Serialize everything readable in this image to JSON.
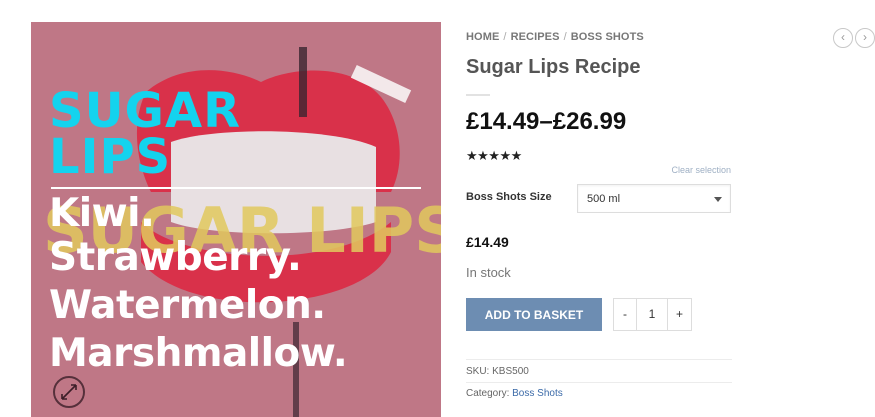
{
  "image": {
    "title_line1": "SUGAR",
    "title_line2": "LIPS",
    "flavors": [
      "Kiwi.",
      "Strawberry.",
      "Watermelon.",
      "Marshmallow."
    ],
    "background_color": "#bf7786",
    "title_color": "#14d3ee",
    "watermark_text": "SUGAR LIPS"
  },
  "breadcrumb": {
    "items": [
      "HOME",
      "RECIPES",
      "BOSS SHOTS"
    ],
    "separator": "/"
  },
  "nav": {
    "prev_icon": "‹",
    "next_icon": "›"
  },
  "product": {
    "title": "Sugar Lips Recipe",
    "price_range": "£14.49–£26.99",
    "rating_stars": 5,
    "rating_glyphs": "★★★★★",
    "clear_selection": "Clear selection",
    "variation_label": "Boss Shots Size",
    "variation_selected": "500 ml",
    "variation_price": "£14.49",
    "stock": "In stock",
    "add_to_basket": "ADD TO BASKET",
    "quantity": {
      "minus": "-",
      "value": "1",
      "plus": "+"
    },
    "sku_label": "SKU:",
    "sku_value": "KBS500",
    "category_label": "Category:",
    "category_value": "Boss Shots"
  },
  "colors": {
    "button": "#6d8db2",
    "link": "#3b6aa8"
  }
}
